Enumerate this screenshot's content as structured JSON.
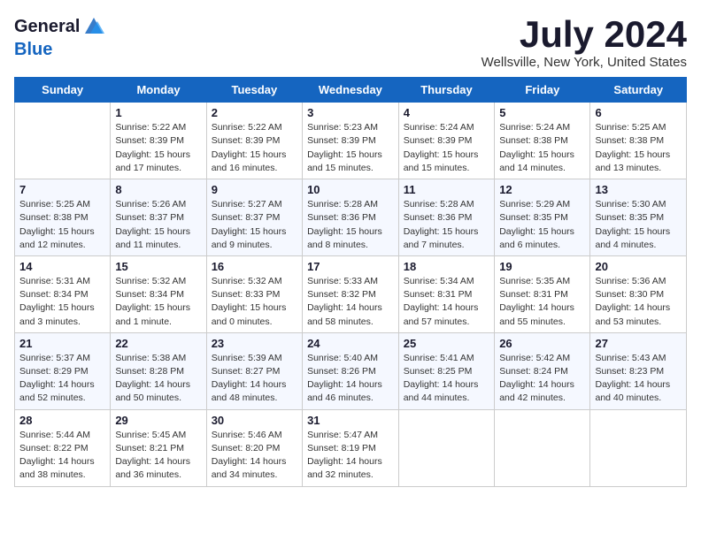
{
  "header": {
    "logo_line1": "General",
    "logo_line2": "Blue",
    "month_title": "July 2024",
    "location": "Wellsville, New York, United States"
  },
  "days_of_week": [
    "Sunday",
    "Monday",
    "Tuesday",
    "Wednesday",
    "Thursday",
    "Friday",
    "Saturday"
  ],
  "weeks": [
    [
      {
        "day": "",
        "info": ""
      },
      {
        "day": "1",
        "info": "Sunrise: 5:22 AM\nSunset: 8:39 PM\nDaylight: 15 hours\nand 17 minutes."
      },
      {
        "day": "2",
        "info": "Sunrise: 5:22 AM\nSunset: 8:39 PM\nDaylight: 15 hours\nand 16 minutes."
      },
      {
        "day": "3",
        "info": "Sunrise: 5:23 AM\nSunset: 8:39 PM\nDaylight: 15 hours\nand 15 minutes."
      },
      {
        "day": "4",
        "info": "Sunrise: 5:24 AM\nSunset: 8:39 PM\nDaylight: 15 hours\nand 15 minutes."
      },
      {
        "day": "5",
        "info": "Sunrise: 5:24 AM\nSunset: 8:38 PM\nDaylight: 15 hours\nand 14 minutes."
      },
      {
        "day": "6",
        "info": "Sunrise: 5:25 AM\nSunset: 8:38 PM\nDaylight: 15 hours\nand 13 minutes."
      }
    ],
    [
      {
        "day": "7",
        "info": "Sunrise: 5:25 AM\nSunset: 8:38 PM\nDaylight: 15 hours\nand 12 minutes."
      },
      {
        "day": "8",
        "info": "Sunrise: 5:26 AM\nSunset: 8:37 PM\nDaylight: 15 hours\nand 11 minutes."
      },
      {
        "day": "9",
        "info": "Sunrise: 5:27 AM\nSunset: 8:37 PM\nDaylight: 15 hours\nand 9 minutes."
      },
      {
        "day": "10",
        "info": "Sunrise: 5:28 AM\nSunset: 8:36 PM\nDaylight: 15 hours\nand 8 minutes."
      },
      {
        "day": "11",
        "info": "Sunrise: 5:28 AM\nSunset: 8:36 PM\nDaylight: 15 hours\nand 7 minutes."
      },
      {
        "day": "12",
        "info": "Sunrise: 5:29 AM\nSunset: 8:35 PM\nDaylight: 15 hours\nand 6 minutes."
      },
      {
        "day": "13",
        "info": "Sunrise: 5:30 AM\nSunset: 8:35 PM\nDaylight: 15 hours\nand 4 minutes."
      }
    ],
    [
      {
        "day": "14",
        "info": "Sunrise: 5:31 AM\nSunset: 8:34 PM\nDaylight: 15 hours\nand 3 minutes."
      },
      {
        "day": "15",
        "info": "Sunrise: 5:32 AM\nSunset: 8:34 PM\nDaylight: 15 hours\nand 1 minute."
      },
      {
        "day": "16",
        "info": "Sunrise: 5:32 AM\nSunset: 8:33 PM\nDaylight: 15 hours\nand 0 minutes."
      },
      {
        "day": "17",
        "info": "Sunrise: 5:33 AM\nSunset: 8:32 PM\nDaylight: 14 hours\nand 58 minutes."
      },
      {
        "day": "18",
        "info": "Sunrise: 5:34 AM\nSunset: 8:31 PM\nDaylight: 14 hours\nand 57 minutes."
      },
      {
        "day": "19",
        "info": "Sunrise: 5:35 AM\nSunset: 8:31 PM\nDaylight: 14 hours\nand 55 minutes."
      },
      {
        "day": "20",
        "info": "Sunrise: 5:36 AM\nSunset: 8:30 PM\nDaylight: 14 hours\nand 53 minutes."
      }
    ],
    [
      {
        "day": "21",
        "info": "Sunrise: 5:37 AM\nSunset: 8:29 PM\nDaylight: 14 hours\nand 52 minutes."
      },
      {
        "day": "22",
        "info": "Sunrise: 5:38 AM\nSunset: 8:28 PM\nDaylight: 14 hours\nand 50 minutes."
      },
      {
        "day": "23",
        "info": "Sunrise: 5:39 AM\nSunset: 8:27 PM\nDaylight: 14 hours\nand 48 minutes."
      },
      {
        "day": "24",
        "info": "Sunrise: 5:40 AM\nSunset: 8:26 PM\nDaylight: 14 hours\nand 46 minutes."
      },
      {
        "day": "25",
        "info": "Sunrise: 5:41 AM\nSunset: 8:25 PM\nDaylight: 14 hours\nand 44 minutes."
      },
      {
        "day": "26",
        "info": "Sunrise: 5:42 AM\nSunset: 8:24 PM\nDaylight: 14 hours\nand 42 minutes."
      },
      {
        "day": "27",
        "info": "Sunrise: 5:43 AM\nSunset: 8:23 PM\nDaylight: 14 hours\nand 40 minutes."
      }
    ],
    [
      {
        "day": "28",
        "info": "Sunrise: 5:44 AM\nSunset: 8:22 PM\nDaylight: 14 hours\nand 38 minutes."
      },
      {
        "day": "29",
        "info": "Sunrise: 5:45 AM\nSunset: 8:21 PM\nDaylight: 14 hours\nand 36 minutes."
      },
      {
        "day": "30",
        "info": "Sunrise: 5:46 AM\nSunset: 8:20 PM\nDaylight: 14 hours\nand 34 minutes."
      },
      {
        "day": "31",
        "info": "Sunrise: 5:47 AM\nSunset: 8:19 PM\nDaylight: 14 hours\nand 32 minutes."
      },
      {
        "day": "",
        "info": ""
      },
      {
        "day": "",
        "info": ""
      },
      {
        "day": "",
        "info": ""
      }
    ]
  ]
}
